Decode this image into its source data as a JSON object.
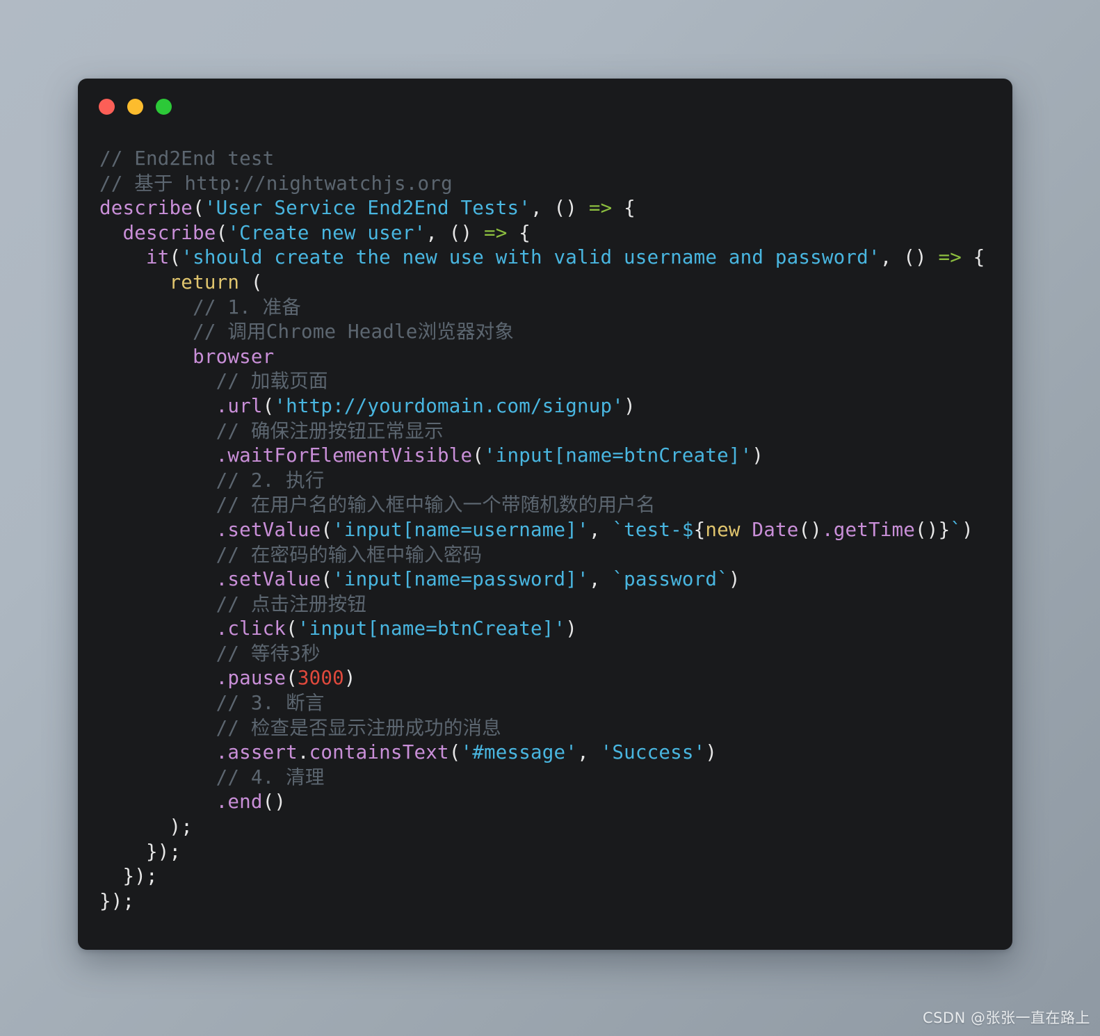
{
  "window": {
    "title_bar": {
      "buttons": [
        {
          "name": "close-button",
          "label": "close",
          "color": "#fc5f57"
        },
        {
          "name": "minimize-button",
          "label": "minimize",
          "color": "#fcbc2e"
        },
        {
          "name": "maximize-button",
          "label": "maximize",
          "color": "#2cc938"
        }
      ]
    },
    "background": "#191a1c"
  },
  "theme": {
    "page_background_top": "#b1bac4",
    "page_background_bottom": "#8f99a3",
    "comment": "#5c6670",
    "function": "#c98fd8",
    "string": "#49b6e0",
    "keyword": "#e0c56e",
    "arrow": "#8cbe3f",
    "number": "#e0493c",
    "punctuation": "#e6e6e6"
  },
  "code": {
    "language": "javascript",
    "lines": [
      "// End2End test",
      "// 基于 http://nightwatchjs.org",
      "describe('User Service End2End Tests', () => {",
      "  describe('Create new user', () => {",
      "    it('should create the new use with valid username and password', () => {",
      "      return (",
      "        // 1. 准备",
      "        // 调用Chrome Headle浏览器对象",
      "        browser",
      "          // 加载页面",
      "          .url('http://yourdomain.com/signup')",
      "          // 确保注册按钮正常显示",
      "          .waitForElementVisible('input[name=btnCreate]')",
      "          // 2. 执行",
      "          // 在用户名的输入框中输入一个带随机数的用户名",
      "          .setValue('input[name=username]', `test-${new Date().getTime()}`)",
      "          // 在密码的输入框中输入密码",
      "          .setValue('input[name=password]', `password`)",
      "          // 点击注册按钮",
      "          .click('input[name=btnCreate]')",
      "          // 等待3秒",
      "          .pause(3000)",
      "          // 3. 断言",
      "          // 检查是否显示注册成功的消息",
      "          .assert.containsText('#message', 'Success')",
      "          // 4. 清理",
      "          .end()",
      "      );",
      "    });",
      "  });",
      "});"
    ],
    "tokens": [
      [
        {
          "t": "// End2End test",
          "c": "cmt"
        }
      ],
      [
        {
          "t": "// 基于 http://nightwatchjs.org",
          "c": "cmt"
        }
      ],
      [
        {
          "t": "describe",
          "c": "fn"
        },
        {
          "t": "(",
          "c": "pun"
        },
        {
          "t": "'User Service End2End Tests'",
          "c": "str"
        },
        {
          "t": ", () ",
          "c": "pun"
        },
        {
          "t": "=>",
          "c": "arw"
        },
        {
          "t": " {",
          "c": "pun"
        }
      ],
      [
        {
          "t": "  ",
          "c": "pun"
        },
        {
          "t": "describe",
          "c": "fn"
        },
        {
          "t": "(",
          "c": "pun"
        },
        {
          "t": "'Create new user'",
          "c": "str"
        },
        {
          "t": ", () ",
          "c": "pun"
        },
        {
          "t": "=>",
          "c": "arw"
        },
        {
          "t": " {",
          "c": "pun"
        }
      ],
      [
        {
          "t": "    ",
          "c": "pun"
        },
        {
          "t": "it",
          "c": "fn"
        },
        {
          "t": "(",
          "c": "pun"
        },
        {
          "t": "'should create the new use with valid username and password'",
          "c": "str"
        },
        {
          "t": ", () ",
          "c": "pun"
        },
        {
          "t": "=>",
          "c": "arw"
        },
        {
          "t": " {",
          "c": "pun"
        }
      ],
      [
        {
          "t": "      ",
          "c": "pun"
        },
        {
          "t": "return",
          "c": "kw"
        },
        {
          "t": " (",
          "c": "pun"
        }
      ],
      [
        {
          "t": "        ",
          "c": "pun"
        },
        {
          "t": "// 1. 准备",
          "c": "cmt"
        }
      ],
      [
        {
          "t": "        ",
          "c": "pun"
        },
        {
          "t": "// 调用Chrome Headle浏览器对象",
          "c": "cmt"
        }
      ],
      [
        {
          "t": "        ",
          "c": "pun"
        },
        {
          "t": "browser",
          "c": "fn"
        }
      ],
      [
        {
          "t": "          ",
          "c": "pun"
        },
        {
          "t": "// 加载页面",
          "c": "cmt"
        }
      ],
      [
        {
          "t": "          ",
          "c": "pun"
        },
        {
          "t": ".url",
          "c": "fn"
        },
        {
          "t": "(",
          "c": "pun"
        },
        {
          "t": "'http://yourdomain.com/signup'",
          "c": "str"
        },
        {
          "t": ")",
          "c": "pun"
        }
      ],
      [
        {
          "t": "          ",
          "c": "pun"
        },
        {
          "t": "// 确保注册按钮正常显示",
          "c": "cmt"
        }
      ],
      [
        {
          "t": "          ",
          "c": "pun"
        },
        {
          "t": ".waitForElementVisible",
          "c": "fn"
        },
        {
          "t": "(",
          "c": "pun"
        },
        {
          "t": "'input[name=btnCreate]'",
          "c": "str"
        },
        {
          "t": ")",
          "c": "pun"
        }
      ],
      [
        {
          "t": "          ",
          "c": "pun"
        },
        {
          "t": "// 2. 执行",
          "c": "cmt"
        }
      ],
      [
        {
          "t": "          ",
          "c": "pun"
        },
        {
          "t": "// 在用户名的输入框中输入一个带随机数的用户名",
          "c": "cmt"
        }
      ],
      [
        {
          "t": "          ",
          "c": "pun"
        },
        {
          "t": ".setValue",
          "c": "fn"
        },
        {
          "t": "(",
          "c": "pun"
        },
        {
          "t": "'input[name=username]'",
          "c": "str"
        },
        {
          "t": ", ",
          "c": "pun"
        },
        {
          "t": "`test-$",
          "c": "str"
        },
        {
          "t": "{",
          "c": "pun"
        },
        {
          "t": "new",
          "c": "kw"
        },
        {
          "t": " ",
          "c": "pun"
        },
        {
          "t": "Date",
          "c": "fn"
        },
        {
          "t": "()",
          "c": "pun"
        },
        {
          "t": ".getTime",
          "c": "fn"
        },
        {
          "t": "()",
          "c": "pun"
        },
        {
          "t": "}",
          "c": "pun"
        },
        {
          "t": "`",
          "c": "str"
        },
        {
          "t": ")",
          "c": "pun"
        }
      ],
      [
        {
          "t": "          ",
          "c": "pun"
        },
        {
          "t": "// 在密码的输入框中输入密码",
          "c": "cmt"
        }
      ],
      [
        {
          "t": "          ",
          "c": "pun"
        },
        {
          "t": ".setValue",
          "c": "fn"
        },
        {
          "t": "(",
          "c": "pun"
        },
        {
          "t": "'input[name=password]'",
          "c": "str"
        },
        {
          "t": ", ",
          "c": "pun"
        },
        {
          "t": "`password`",
          "c": "str"
        },
        {
          "t": ")",
          "c": "pun"
        }
      ],
      [
        {
          "t": "          ",
          "c": "pun"
        },
        {
          "t": "// 点击注册按钮",
          "c": "cmt"
        }
      ],
      [
        {
          "t": "          ",
          "c": "pun"
        },
        {
          "t": ".click",
          "c": "fn"
        },
        {
          "t": "(",
          "c": "pun"
        },
        {
          "t": "'input[name=btnCreate]'",
          "c": "str"
        },
        {
          "t": ")",
          "c": "pun"
        }
      ],
      [
        {
          "t": "          ",
          "c": "pun"
        },
        {
          "t": "// 等待3秒",
          "c": "cmt"
        }
      ],
      [
        {
          "t": "          ",
          "c": "pun"
        },
        {
          "t": ".pause",
          "c": "fn"
        },
        {
          "t": "(",
          "c": "pun"
        },
        {
          "t": "3000",
          "c": "num"
        },
        {
          "t": ")",
          "c": "pun"
        }
      ],
      [
        {
          "t": "          ",
          "c": "pun"
        },
        {
          "t": "// 3. 断言",
          "c": "cmt"
        }
      ],
      [
        {
          "t": "          ",
          "c": "pun"
        },
        {
          "t": "// 检查是否显示注册成功的消息",
          "c": "cmt"
        }
      ],
      [
        {
          "t": "          ",
          "c": "pun"
        },
        {
          "t": ".assert",
          "c": "fn"
        },
        {
          "t": ".",
          "c": "pun"
        },
        {
          "t": "containsText",
          "c": "fn"
        },
        {
          "t": "(",
          "c": "pun"
        },
        {
          "t": "'#message'",
          "c": "str"
        },
        {
          "t": ", ",
          "c": "pun"
        },
        {
          "t": "'Success'",
          "c": "str"
        },
        {
          "t": ")",
          "c": "pun"
        }
      ],
      [
        {
          "t": "          ",
          "c": "pun"
        },
        {
          "t": "// 4. 清理",
          "c": "cmt"
        }
      ],
      [
        {
          "t": "          ",
          "c": "pun"
        },
        {
          "t": ".end",
          "c": "fn"
        },
        {
          "t": "()",
          "c": "pun"
        }
      ],
      [
        {
          "t": "      );",
          "c": "pun"
        }
      ],
      [
        {
          "t": "    });",
          "c": "pun"
        }
      ],
      [
        {
          "t": "  });",
          "c": "pun"
        }
      ],
      [
        {
          "t": "});",
          "c": "pun"
        }
      ]
    ]
  },
  "watermark": {
    "text": "CSDN @张张一直在路上"
  }
}
